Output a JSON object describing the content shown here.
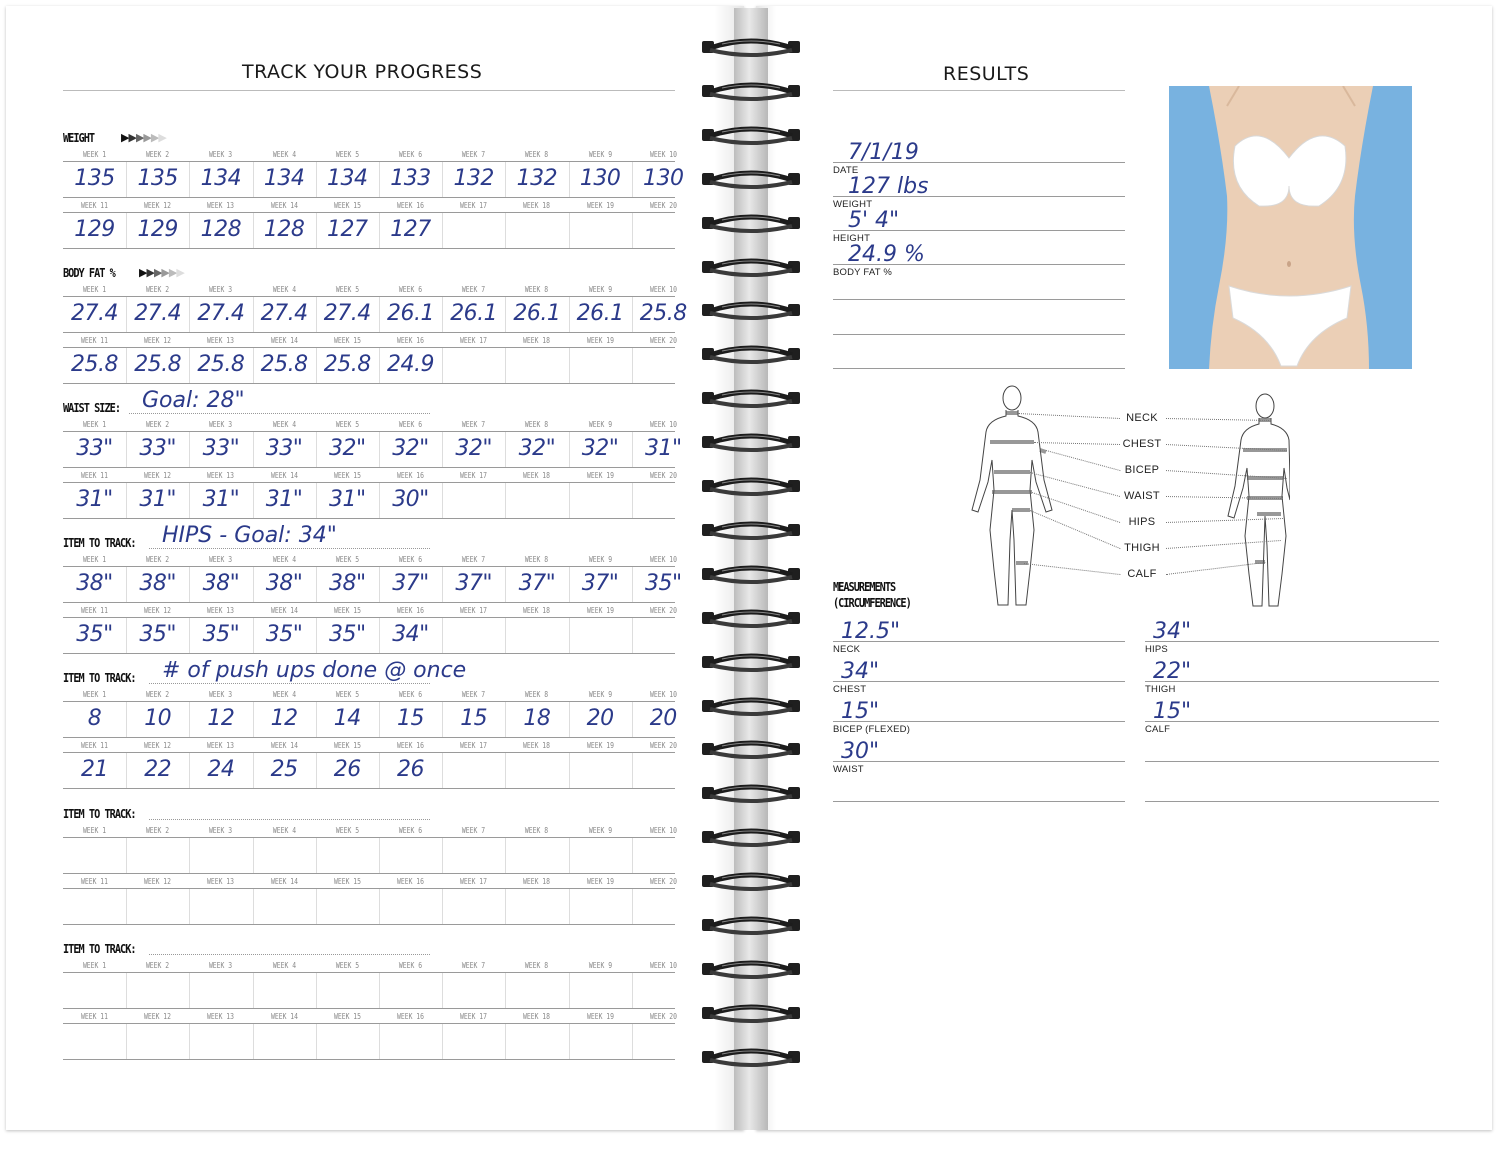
{
  "left_page": {
    "title": "TRACK YOUR PROGRESS",
    "week_labels_top": [
      "WEEK 1",
      "WEEK 2",
      "WEEK 3",
      "WEEK 4",
      "WEEK 5",
      "WEEK 6",
      "WEEK 7",
      "WEEK 8",
      "WEEK 9",
      "WEEK 10"
    ],
    "week_labels_bottom": [
      "WEEK 11",
      "WEEK 12",
      "WEEK 13",
      "WEEK 14",
      "WEEK 15",
      "WEEK 16",
      "WEEK 17",
      "WEEK 18",
      "WEEK 19",
      "WEEK 20"
    ],
    "sections": [
      {
        "label": "WEIGHT",
        "handwritten": "",
        "arrows": true,
        "row1": [
          "135",
          "135",
          "134",
          "134",
          "134",
          "133",
          "132",
          "132",
          "130",
          "130"
        ],
        "row2": [
          "129",
          "129",
          "128",
          "128",
          "127",
          "127",
          "",
          "",
          "",
          ""
        ]
      },
      {
        "label": "BODY FAT %",
        "handwritten": "",
        "arrows": true,
        "row1": [
          "27.4",
          "27.4",
          "27.4",
          "27.4",
          "27.4",
          "26.1",
          "26.1",
          "26.1",
          "26.1",
          "25.8"
        ],
        "row2": [
          "25.8",
          "25.8",
          "25.8",
          "25.8",
          "25.8",
          "24.9",
          "",
          "",
          "",
          ""
        ]
      },
      {
        "label": "WAIST SIZE:",
        "handwritten": "Goal: 28\"",
        "arrows": false,
        "row1": [
          "33\"",
          "33\"",
          "33\"",
          "33\"",
          "32\"",
          "32\"",
          "32\"",
          "32\"",
          "32\"",
          "31\""
        ],
        "row2": [
          "31\"",
          "31\"",
          "31\"",
          "31\"",
          "31\"",
          "30\"",
          "",
          "",
          "",
          ""
        ]
      },
      {
        "label": "ITEM TO TRACK:",
        "handwritten": "HIPS - Goal: 34\"",
        "arrows": false,
        "row1": [
          "38\"",
          "38\"",
          "38\"",
          "38\"",
          "38\"",
          "37\"",
          "37\"",
          "37\"",
          "37\"",
          "35\""
        ],
        "row2": [
          "35\"",
          "35\"",
          "35\"",
          "35\"",
          "35\"",
          "34\"",
          "",
          "",
          "",
          ""
        ]
      },
      {
        "label": "ITEM TO TRACK:",
        "handwritten": "# of push ups done @ once",
        "arrows": false,
        "row1": [
          "8",
          "10",
          "12",
          "12",
          "14",
          "15",
          "15",
          "18",
          "20",
          "20"
        ],
        "row2": [
          "21",
          "22",
          "24",
          "25",
          "26",
          "26",
          "",
          "",
          "",
          ""
        ]
      },
      {
        "label": "ITEM TO TRACK:",
        "handwritten": "",
        "arrows": false,
        "row1": [
          "",
          "",
          "",
          "",
          "",
          "",
          "",
          "",
          "",
          ""
        ],
        "row2": [
          "",
          "",
          "",
          "",
          "",
          "",
          "",
          "",
          "",
          ""
        ]
      },
      {
        "label": "ITEM TO TRACK:",
        "handwritten": "",
        "arrows": false,
        "row1": [
          "",
          "",
          "",
          "",
          "",
          "",
          "",
          "",
          "",
          ""
        ],
        "row2": [
          "",
          "",
          "",
          "",
          "",
          "",
          "",
          "",
          "",
          ""
        ]
      }
    ]
  },
  "right_page": {
    "title": "RESULTS",
    "fields": [
      {
        "label": "DATE",
        "value": "7/1/19"
      },
      {
        "label": "WEIGHT",
        "value": "127 lbs"
      },
      {
        "label": "HEIGHT",
        "value": "5' 4\""
      },
      {
        "label": "BODY FAT %",
        "value": "24.9 %"
      }
    ],
    "body_diagram_labels": [
      "NECK",
      "CHEST",
      "BICEP",
      "WAIST",
      "HIPS",
      "THIGH",
      "CALF"
    ],
    "measurements_title_line1": "MEASUREMENTS",
    "measurements_title_line2": "(CIRCUMFERENCE)",
    "measurements_left": [
      {
        "label": "NECK",
        "value": "12.5\""
      },
      {
        "label": "CHEST",
        "value": "34\""
      },
      {
        "label": "BICEP (FLEXED)",
        "value": "15\""
      },
      {
        "label": "WAIST",
        "value": "30\""
      }
    ],
    "measurements_right": [
      {
        "label": "HIPS",
        "value": "34\""
      },
      {
        "label": "THIGH",
        "value": "22\""
      },
      {
        "label": "CALF",
        "value": "15\""
      }
    ]
  },
  "colors": {
    "handwriting": "#2b3a8a",
    "photo_background": "#78b2e0",
    "ring": "#2a2a2a"
  }
}
